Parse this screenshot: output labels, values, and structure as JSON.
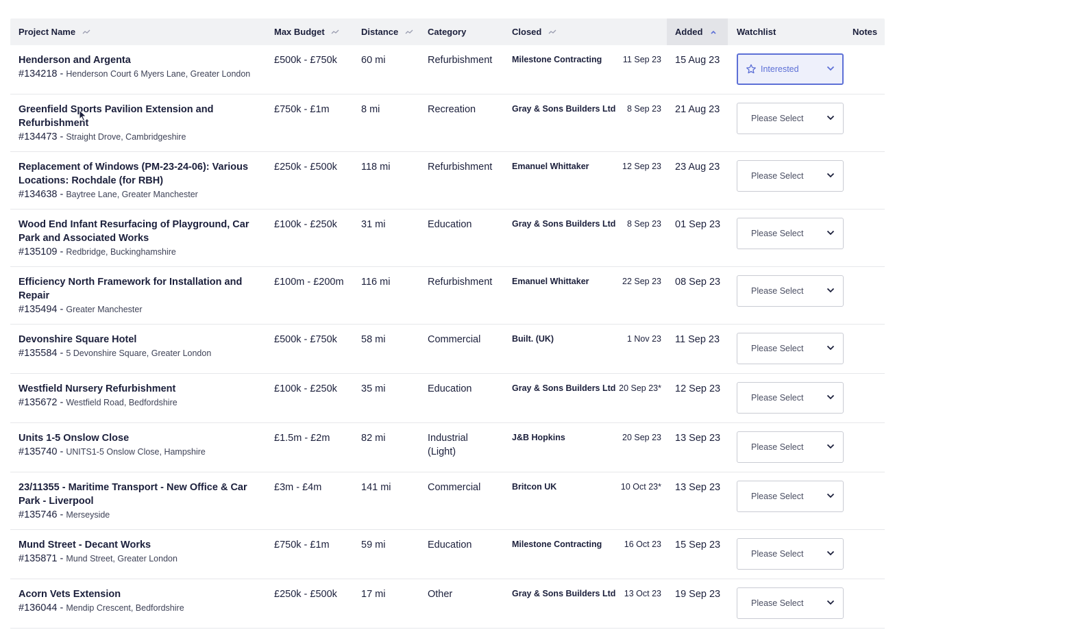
{
  "table": {
    "headers": {
      "project_name": "Project Name",
      "max_budget": "Max Budget",
      "distance": "Distance",
      "category": "Category",
      "closed": "Closed",
      "added": "Added",
      "watchlist": "Watchlist",
      "notes": "Notes"
    },
    "rows": [
      {
        "name": "Henderson and Argenta",
        "id": "#134218",
        "location": "Henderson Court 6 Myers Lane, Greater London",
        "budget": "£500k - £750k",
        "distance": "60 mi",
        "category": "Refurbishment",
        "contractor": "Milestone Contracting",
        "closed": "11 Sep 23",
        "added": "15 Aug 23",
        "watchlist": "Interested"
      },
      {
        "name": "Greenfield Sports Pavilion Extension and Refurbishment",
        "id": "#134473",
        "location": "Straight Drove, Cambridgeshire",
        "budget": "£750k - £1m",
        "distance": "8 mi",
        "category": "Recreation",
        "contractor": "Gray & Sons Builders Ltd",
        "closed": "8 Sep 23",
        "added": "21 Aug 23",
        "watchlist": "Please Select"
      },
      {
        "name": "Replacement of Windows (PM-23-24-06): Various Locations: Rochdale (for RBH)",
        "id": "#134638",
        "location": "Baytree Lane, Greater Manchester",
        "budget": "£250k - £500k",
        "distance": "118 mi",
        "category": "Refurbishment",
        "contractor": "Emanuel Whittaker",
        "closed": "12 Sep 23",
        "added": "23 Aug 23",
        "watchlist": "Please Select"
      },
      {
        "name": "Wood End Infant Resurfacing of Playground, Car Park and Associated Works",
        "id": "#135109",
        "location": "Redbridge, Buckinghamshire",
        "budget": "£100k - £250k",
        "distance": "31 mi",
        "category": "Education",
        "contractor": "Gray & Sons Builders Ltd",
        "closed": "8 Sep 23",
        "added": "01 Sep 23",
        "watchlist": "Please Select"
      },
      {
        "name": "Efficiency North Framework for Installation and Repair",
        "id": "#135494",
        "location": "Greater Manchester",
        "budget": "£100m - £200m",
        "distance": "116 mi",
        "category": "Refurbishment",
        "contractor": "Emanuel Whittaker",
        "closed": "22 Sep 23",
        "added": "08 Sep 23",
        "watchlist": "Please Select"
      },
      {
        "name": "Devonshire Square Hotel",
        "id": "#135584",
        "location": "5 Devonshire Square, Greater London",
        "budget": "£500k - £750k",
        "distance": "58 mi",
        "category": "Commercial",
        "contractor": "Built. (UK)",
        "closed": "1 Nov 23",
        "added": "11 Sep 23",
        "watchlist": "Please Select"
      },
      {
        "name": "Westfield Nursery Refurbishment",
        "id": "#135672",
        "location": "Westfield Road, Bedfordshire",
        "budget": "£100k - £250k",
        "distance": "35 mi",
        "category": "Education",
        "contractor": "Gray & Sons Builders Ltd",
        "closed": "20 Sep 23*",
        "added": "12 Sep 23",
        "watchlist": "Please Select"
      },
      {
        "name": "Units 1-5 Onslow Close",
        "id": "#135740",
        "location": "UNITS1-5 Onslow Close, Hampshire",
        "budget": "£1.5m - £2m",
        "distance": "82 mi",
        "category": "Industrial (Light)",
        "contractor": "J&B Hopkins",
        "closed": "20 Sep 23",
        "added": "13 Sep 23",
        "watchlist": "Please Select"
      },
      {
        "name": "23/11355 - Maritime Transport - New Office & Car Park - Liverpool",
        "id": "#135746",
        "location": "Merseyside",
        "budget": "£3m - £4m",
        "distance": "141 mi",
        "category": "Commercial",
        "contractor": "Britcon UK",
        "closed": "10 Oct 23*",
        "added": "13 Sep 23",
        "watchlist": "Please Select"
      },
      {
        "name": "Mund Street - Decant Works",
        "id": "#135871",
        "location": "Mund Street, Greater London",
        "budget": "£750k - £1m",
        "distance": "59 mi",
        "category": "Education",
        "contractor": "Milestone Contracting",
        "closed": "16 Oct 23",
        "added": "15 Sep 23",
        "watchlist": "Please Select"
      },
      {
        "name": "Acorn Vets Extension",
        "id": "#136044",
        "location": "Mendip Crescent, Bedfordshire",
        "budget": "£250k - £500k",
        "distance": "17 mi",
        "category": "Other",
        "contractor": "Gray & Sons Builders Ltd",
        "closed": "13 Oct 23",
        "added": "19 Sep 23",
        "watchlist": "Please Select"
      }
    ]
  },
  "icons": {
    "sort": "sort-icon",
    "sort_asc": "sort-ascending-icon",
    "star": "star-icon",
    "chevron": "chevron-down-icon",
    "cursor": "mouse-cursor-icon"
  },
  "colors": {
    "header_bg": "#f1f2f4",
    "active_header_bg": "#e3e4e8",
    "accent": "#5c6fd6",
    "text": "#1b1f3b",
    "divider": "#e6e7ea"
  }
}
